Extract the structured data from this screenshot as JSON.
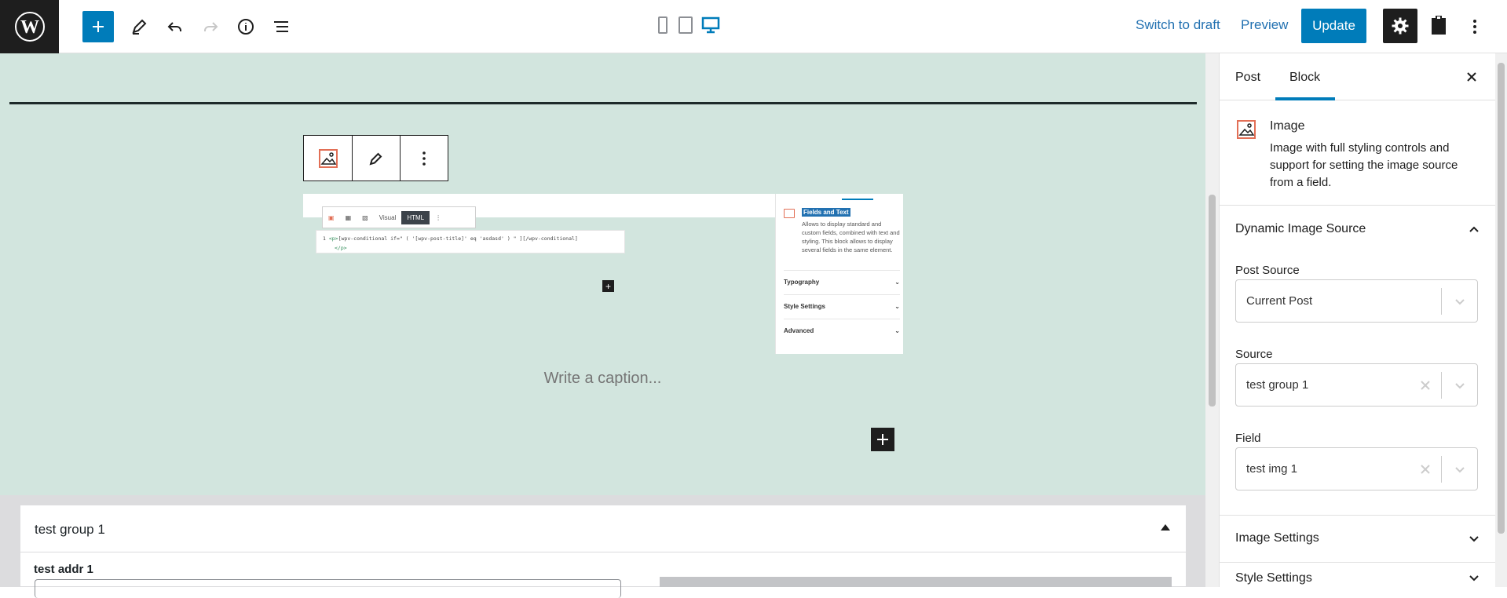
{
  "topbar": {
    "switch_to_draft": "Switch to draft",
    "preview": "Preview",
    "update": "Update"
  },
  "canvas": {
    "caption_placeholder": "Write a caption...",
    "embedded": {
      "toolbar_visual": "Visual",
      "toolbar_html": "HTML",
      "code_line_number": "1",
      "code_line_1_tag": "<p>",
      "code_line_1": "[wpv-conditional if=\" ( '[wpv-post-title]' eq 'asdasd' ) \" ][/wpv-conditional]",
      "code_line_2": "</p>",
      "panel_title": "Fields and Text",
      "panel_desc": "Allows to display standard and custom fields, combined with text and styling. This block allows to display several fields in the same element.",
      "panel_rows": [
        "Typography",
        "Style Settings",
        "Advanced"
      ]
    }
  },
  "metabox": {
    "title": "test group 1",
    "field_label": "test addr 1"
  },
  "sidebar": {
    "tabs": [
      "Post",
      "Block"
    ],
    "block": {
      "title": "Image",
      "description": "Image with full styling controls and support for setting the image source from a field."
    },
    "dynamic_source": {
      "title": "Dynamic Image Source",
      "post_source_label": "Post Source",
      "post_source_value": "Current Post",
      "source_label": "Source",
      "source_value": "test group 1",
      "field_label": "Field",
      "field_value": "test img 1"
    },
    "image_settings": "Image Settings",
    "style_settings": "Style Settings"
  },
  "colors": {
    "accent": "#007cba",
    "canvas_bg": "#d2e5de",
    "dark": "#1e1e1e"
  }
}
